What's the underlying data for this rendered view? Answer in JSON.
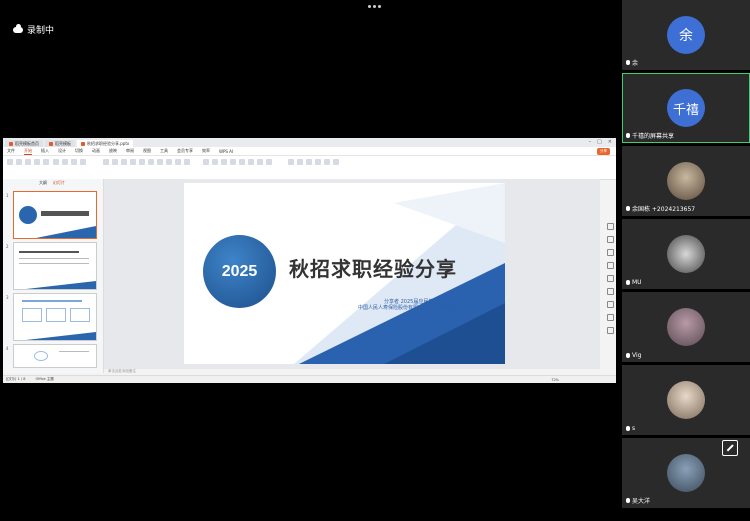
{
  "recording": {
    "label": "录制中"
  },
  "screen": {
    "tabs": [
      {
        "label": "稻壳模板首页"
      },
      {
        "label": "稻壳模板"
      },
      {
        "label": "秋招求职经验分享.pptx"
      }
    ],
    "menu": [
      "文件",
      "开始",
      "插入",
      "设计",
      "切换",
      "动画",
      "放映",
      "审阅",
      "视图",
      "工具",
      "会员专享",
      "效率",
      "WPS AI"
    ],
    "share_label": "分享",
    "panel_tabs": [
      "大纲",
      "幻灯片"
    ],
    "slide": {
      "year": "2025",
      "title": "秋招求职经验分享",
      "line1": "分享者 2025届应届毕业生",
      "line2": "中国人民人寿保险股份有限公司 人力资源部"
    },
    "thumb_numbers": [
      "1",
      "2",
      "3",
      "4"
    ],
    "notes_placeholder": "单击此处添加备注",
    "status": {
      "slide_info": "幻灯片 1 / 8",
      "theme": "Office 主题",
      "zoom": "72%"
    }
  },
  "participants": [
    {
      "avatar_text": "余",
      "name": "余",
      "type": "avatar",
      "color": "#3d6fd4"
    },
    {
      "avatar_text": "千禧",
      "name": "千禧的屏幕共享",
      "type": "avatar",
      "color": "#3d6fd4",
      "highlighted": true
    },
    {
      "name": "余国栋 +2024213657",
      "type": "photo"
    },
    {
      "name": "MU",
      "type": "photo"
    },
    {
      "name": "Vig",
      "type": "photo"
    },
    {
      "name": "s",
      "type": "photo"
    },
    {
      "name": "吴大洋",
      "type": "photo"
    }
  ]
}
